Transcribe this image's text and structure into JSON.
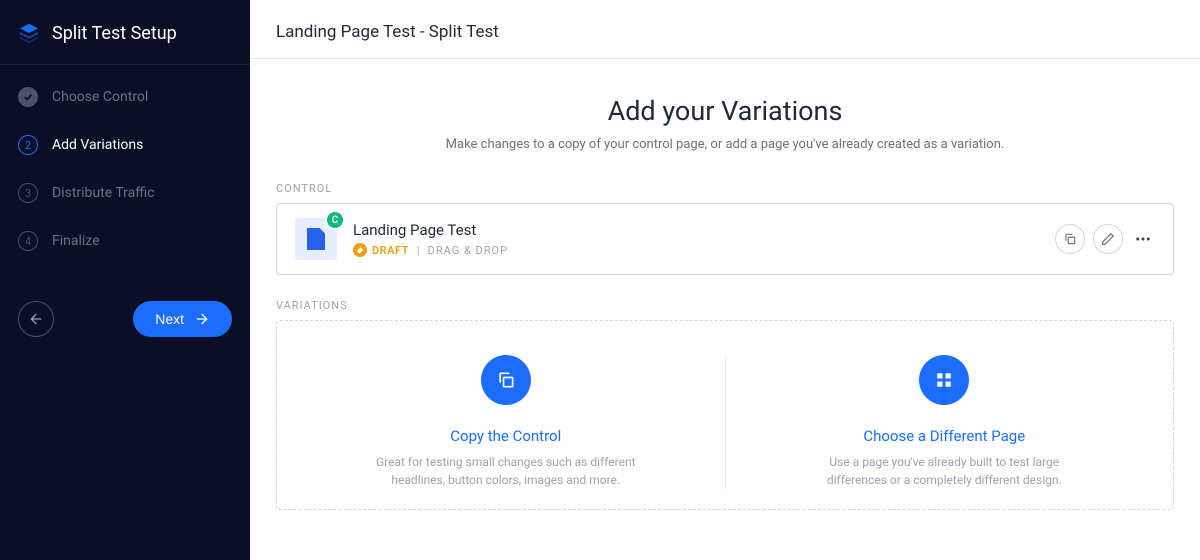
{
  "sidebar": {
    "title": "Split Test Setup",
    "steps": [
      {
        "num": "",
        "label": "Choose Control",
        "state": "done"
      },
      {
        "num": "2",
        "label": "Add Variations",
        "state": "active"
      },
      {
        "num": "3",
        "label": "Distribute Traffic",
        "state": "pending"
      },
      {
        "num": "4",
        "label": "Finalize",
        "state": "pending"
      }
    ],
    "next_label": "Next"
  },
  "header": {
    "title": "Landing Page Test - Split Test"
  },
  "main": {
    "heading": "Add your Variations",
    "subheading": "Make changes to a copy of your control page, or add a page you've already created as a variation.",
    "control_label": "CONTROL",
    "control": {
      "badge": "C",
      "title": "Landing Page Test",
      "status": "DRAFT",
      "type": "DRAG & DROP"
    },
    "variations_label": "VARIATIONS",
    "options": [
      {
        "title": "Copy the Control",
        "desc": "Great for testing small changes such as different headlines, button colors, images and more.",
        "icon": "copy"
      },
      {
        "title": "Choose a Different Page",
        "desc": "Use a page you've already built to test large differences or a completely different design.",
        "icon": "grid"
      }
    ]
  }
}
